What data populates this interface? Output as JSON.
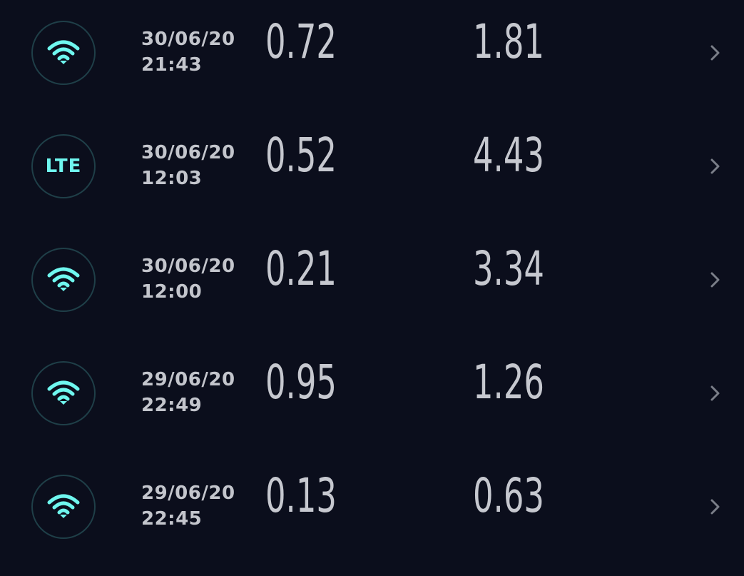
{
  "results": [
    {
      "connection_icon": "wifi-icon",
      "date": "30/06/20",
      "time": "21:43",
      "download": "0.72",
      "upload": "1.81"
    },
    {
      "connection_icon": "lte-icon",
      "connection_label": "LTE",
      "date": "30/06/20",
      "time": "12:03",
      "download": "0.52",
      "upload": "4.43"
    },
    {
      "connection_icon": "wifi-icon",
      "date": "30/06/20",
      "time": "12:00",
      "download": "0.21",
      "upload": "3.34"
    },
    {
      "connection_icon": "wifi-icon",
      "date": "29/06/20",
      "time": "22:49",
      "download": "0.95",
      "upload": "1.26"
    },
    {
      "connection_icon": "wifi-icon",
      "date": "29/06/20",
      "time": "22:45",
      "download": "0.13",
      "upload": "0.63"
    }
  ],
  "colors": {
    "background": "#0b0e1c",
    "accent": "#6ff7ef",
    "badge_border": "#1f3f48",
    "text": "#c6c8cf",
    "chevron": "#7a7e88"
  }
}
